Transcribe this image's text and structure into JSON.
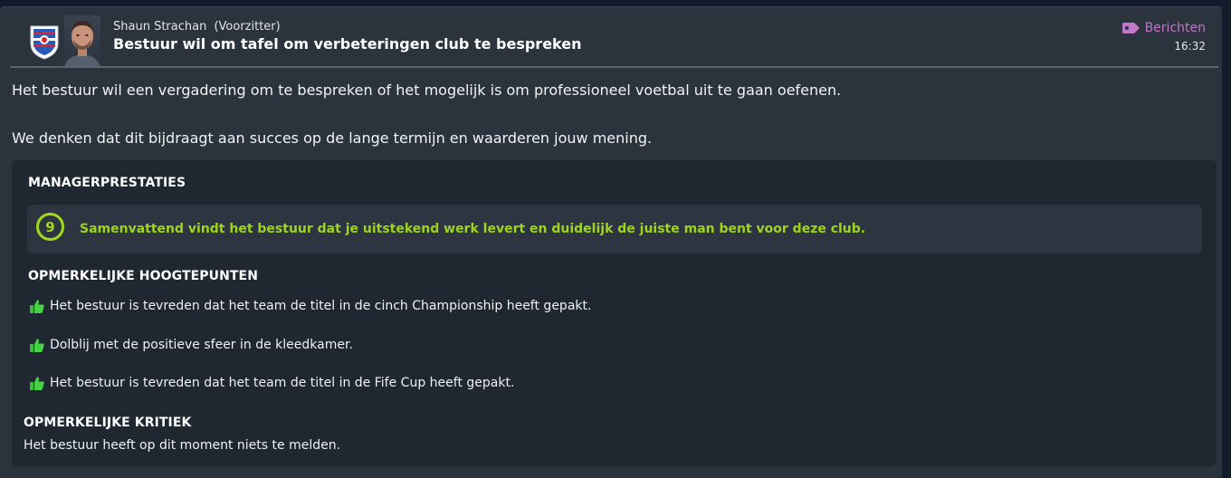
{
  "header": {
    "sender_name": "Shaun Strachan",
    "sender_role": "(Voorzitter)",
    "subject": "Bestuur wil om tafel om verbeteringen club te bespreken",
    "tag_label": "Berichten",
    "tag_icon": "tag-icon",
    "time": "16:32"
  },
  "body": {
    "paragraph1": "Het bestuur wil een vergadering om te bespreken of het mogelijk is om professioneel voetbal uit te gaan oefenen.",
    "paragraph2": "We denken dat dit bijdraagt aan succes op de lange termijn en waarderen jouw mening."
  },
  "performance": {
    "title": "MANAGERPRESTATIES",
    "rating": "9",
    "summary": "Samenvattend vindt het bestuur dat je uitstekend werk levert en duidelijk de juiste man bent voor deze club."
  },
  "highlights": {
    "title": "OPMERKELIJKE HOOGTEPUNTEN",
    "icon": "thumbs-up-icon",
    "items": [
      "Het bestuur is tevreden dat het team de titel in de cinch Championship heeft gepakt.",
      "Dolblij met de positieve sfeer in de kleedkamer.",
      "Het bestuur is tevreden dat het team de titel in de Fife Cup heeft gepakt."
    ]
  },
  "criticism": {
    "title": "OPMERKELIJKE KRITIEK",
    "text": "Het bestuur heeft op dit moment niets te melden."
  },
  "colors": {
    "accent_green": "#a2d91d",
    "tag_purple": "#c176c7",
    "panel_bg": "#2b333d",
    "box_bg": "#1f2731"
  }
}
